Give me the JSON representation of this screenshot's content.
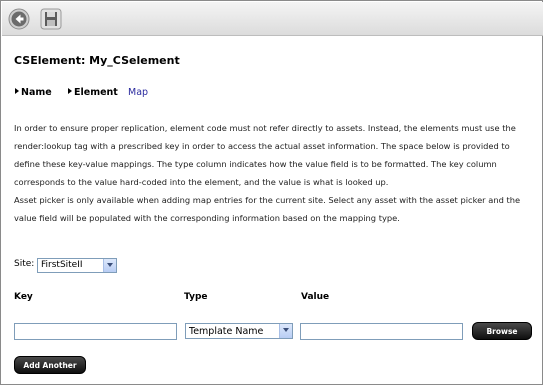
{
  "toolbar": {
    "back_icon": "back-arrow-icon",
    "save_icon": "save-disk-icon"
  },
  "page": {
    "title": "CSElement: My_CSelement"
  },
  "tabs": [
    {
      "label": "Name"
    },
    {
      "label": "Element"
    },
    {
      "label": "Map"
    }
  ],
  "description": {
    "line1": "In order to ensure proper replication, element code must not refer directly to assets. Instead, the elements must use the",
    "line2": "render:lookup tag with a prescribed key in order to access the actual asset information. The space below is provided to",
    "line3": "define these key-value mappings. The type column indicates how the value field is to be formatted. The key column",
    "line4": "corresponds to the value hard-coded into the element, and the value is what is looked up.",
    "line5": "Asset picker is only available when adding map entries for the current site. Select any asset with the asset picker and the",
    "line6": "value field will be populated with the corresponding information based on the mapping type."
  },
  "site": {
    "label": "Site:",
    "selected": "FirstSiteII"
  },
  "mapping": {
    "key_header": "Key",
    "type_header": "Type",
    "value_header": "Value",
    "key_value": "",
    "type_selected": "Template Name",
    "value_value": "",
    "browse_label": "Browse"
  },
  "actions": {
    "add_another_label": "Add Another"
  },
  "colors": {
    "map_tab": "#2a2a9e",
    "button_bg": "#1a1a1a",
    "toolbar_bg": "#e6e6e6"
  }
}
